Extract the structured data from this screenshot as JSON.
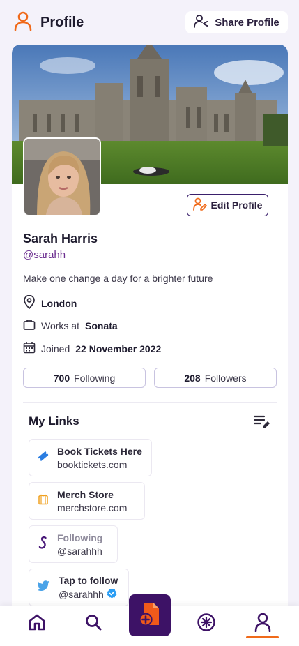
{
  "header": {
    "title": "Profile",
    "share_label": "Share Profile"
  },
  "profile": {
    "edit_label": "Edit Profile",
    "name": "Sarah Harris",
    "handle": "@sarahh",
    "bio": "Make one change a day for a brighter future",
    "location": "London",
    "works_at_label": "Works at",
    "works_at_value": "Sonata",
    "joined_label": "Joined",
    "joined_value": "22 November 2022"
  },
  "stats": {
    "following_count": "700",
    "following_label": "Following",
    "followers_count": "208",
    "followers_label": "Followers"
  },
  "links": {
    "title": "My Links",
    "items": [
      {
        "title": "Book Tickets Here",
        "subtitle": "booktickets.com",
        "icon": "ticket-icon"
      },
      {
        "title": "Merch Store",
        "subtitle": "merchstore.com",
        "icon": "shirt-icon"
      },
      {
        "title": "Following",
        "subtitle": "@sarahhh",
        "icon": "sonata-logo-icon"
      },
      {
        "title": "Tap to follow",
        "subtitle": "@sarahhh",
        "icon": "twitter-icon"
      }
    ]
  },
  "nav": {
    "items": [
      "home-icon",
      "search-icon",
      "create-post-icon",
      "discover-icon",
      "profile-icon"
    ],
    "active": "profile-icon"
  },
  "colors": {
    "accent": "#f06a1a",
    "brand_dark": "#3d1266",
    "handle_purple": "#6b2d8f",
    "border_light": "#c8c3e0"
  }
}
